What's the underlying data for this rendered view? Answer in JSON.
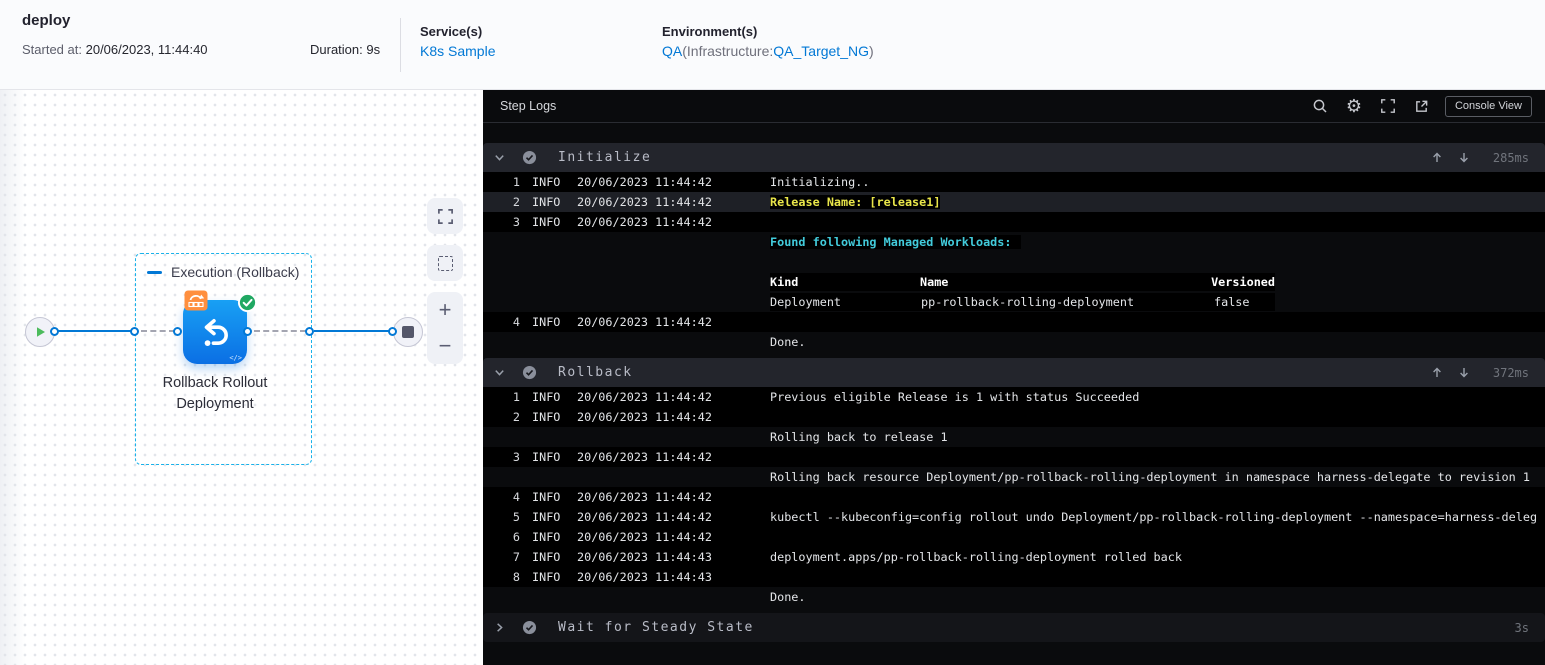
{
  "colors": {
    "accent_blue": "#0278d5",
    "node_blue_top": "#18a0f4",
    "node_blue_bottom": "#0b6fe4",
    "badge_orange": "#ff8f3e",
    "success_green": "#20a862",
    "log_yellow": "#e9e64a",
    "log_cyan": "#42cbdb",
    "console_bg": "#0a0b0d",
    "section_header_bg": "#23252c"
  },
  "header": {
    "title": "deploy",
    "started_label": "Started at:",
    "started_value": "20/06/2023, 11:44:40",
    "duration_label": "Duration:",
    "duration_value": "9s",
    "services_label": "Service(s)",
    "services_value": "K8s Sample",
    "environments_label": "Environment(s)",
    "env_link1": "QA",
    "env_mid": "(Infrastructure:",
    "env_link2": "QA_Target_NG",
    "env_close": ")"
  },
  "graph": {
    "group_label": "Execution (Rollback)",
    "node_label_line1": "Rollback Rollout",
    "node_label_line2": "Deployment",
    "code_glyph": "</>"
  },
  "toolbar": {
    "zoom_in": "+",
    "zoom_out": "−"
  },
  "console": {
    "title": "Step Logs",
    "console_view_label": "Console View",
    "sections": [
      {
        "name": "Initialize",
        "duration": "285ms",
        "collapsed": false,
        "rows": [
          {
            "num": "1",
            "level": "INFO",
            "ts": "20/06/2023 11:44:42",
            "bg": "bar",
            "msg": [
              {
                "t": "Initializing..",
                "s": "plain"
              }
            ]
          },
          {
            "num": "2",
            "level": "INFO",
            "ts": "20/06/2023 11:44:42",
            "bg": "highlight",
            "msg": [
              {
                "t": "Release Name: [release1]",
                "s": "yellow"
              }
            ]
          },
          {
            "num": "3",
            "level": "INFO",
            "ts": "20/06/2023 11:44:42",
            "bg": "bar",
            "msg": []
          },
          {
            "msg": [
              {
                "t": "Found following Managed Workloads: ",
                "s": "cyan"
              }
            ]
          },
          {
            "msg": []
          },
          {
            "table": [
              "Kind",
              "Name",
              "Versioned"
            ],
            "headerRow": true
          },
          {
            "table": [
              "Deployment",
              "pp-rollback-rolling-deployment",
              "false"
            ],
            "headerRow": false
          },
          {
            "num": "4",
            "level": "INFO",
            "ts": "20/06/2023 11:44:42",
            "bg": "bar",
            "msg": []
          },
          {
            "msg": [
              {
                "t": "Done.",
                "s": "plain"
              }
            ]
          }
        ]
      },
      {
        "name": "Rollback",
        "duration": "372ms",
        "collapsed": false,
        "rows": [
          {
            "num": "1",
            "level": "INFO",
            "ts": "20/06/2023 11:44:42",
            "bg": "bar",
            "msg": [
              {
                "t": "Previous eligible Release is 1 with status Succeeded",
                "s": "plain"
              }
            ]
          },
          {
            "num": "2",
            "level": "INFO",
            "ts": "20/06/2023 11:44:42",
            "bg": "bar",
            "msg": []
          },
          {
            "msg": [
              {
                "t": "Rolling back to release 1",
                "s": "plain"
              }
            ]
          },
          {
            "num": "3",
            "level": "INFO",
            "ts": "20/06/2023 11:44:42",
            "bg": "bar",
            "msg": []
          },
          {
            "msg": [
              {
                "t": "Rolling back resource Deployment/pp-rollback-rolling-deployment in namespace harness-delegate to revision 1",
                "s": "plain"
              }
            ]
          },
          {
            "num": "4",
            "level": "INFO",
            "ts": "20/06/2023 11:44:42",
            "bg": "bar",
            "msg": []
          },
          {
            "num": "5",
            "level": "INFO",
            "ts": "20/06/2023 11:44:42",
            "bg": "bar",
            "msg": [
              {
                "t": "kubectl --kubeconfig=config rollout undo Deployment/pp-rollback-rolling-deployment --namespace=harness-deleg",
                "s": "plain"
              }
            ]
          },
          {
            "num": "6",
            "level": "INFO",
            "ts": "20/06/2023 11:44:42",
            "bg": "bar",
            "msg": []
          },
          {
            "num": "7",
            "level": "INFO",
            "ts": "20/06/2023 11:44:43",
            "bg": "bar",
            "msg": [
              {
                "t": "deployment.apps/pp-rollback-rolling-deployment rolled back",
                "s": "plain"
              }
            ]
          },
          {
            "num": "8",
            "level": "INFO",
            "ts": "20/06/2023 11:44:43",
            "bg": "bar",
            "msg": []
          },
          {
            "msg": [
              {
                "t": "Done.",
                "s": "plain"
              }
            ]
          }
        ]
      },
      {
        "name": "Wait for Steady State",
        "duration": "3s",
        "collapsed": true,
        "rows": []
      }
    ]
  }
}
